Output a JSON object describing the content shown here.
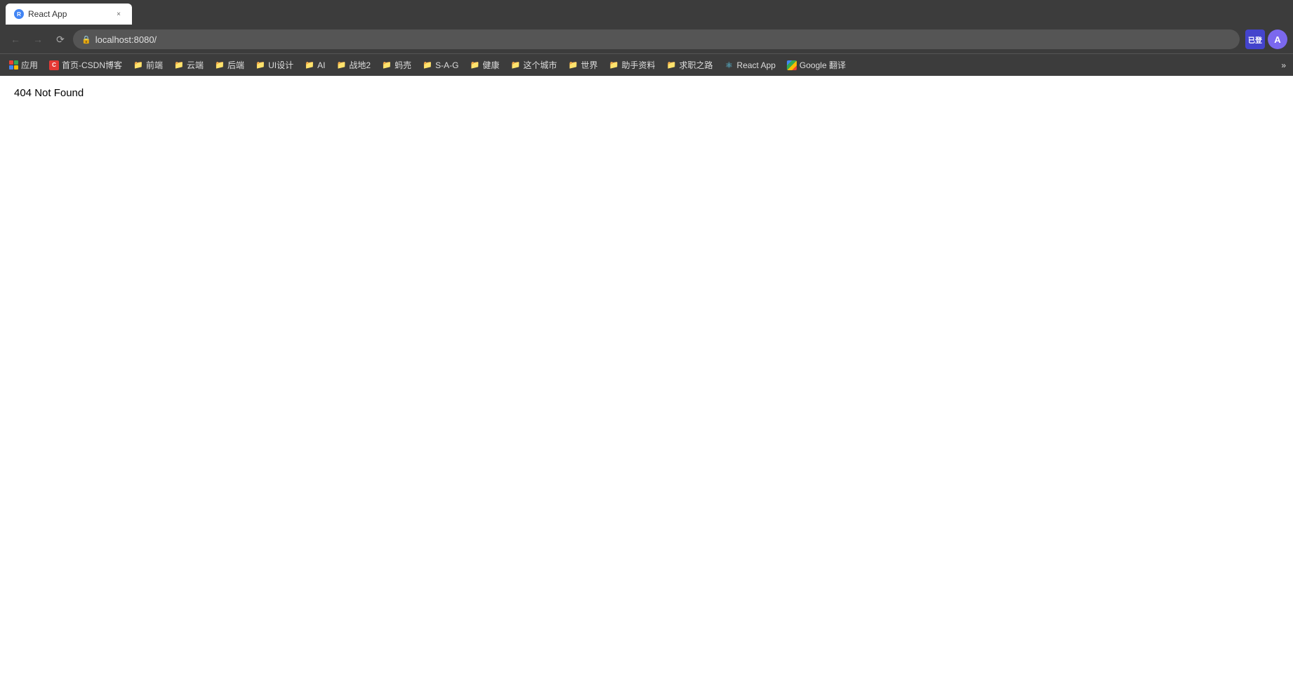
{
  "browser": {
    "tab": {
      "title": "React App",
      "favicon_label": "R"
    },
    "address_bar": {
      "url": "localhost:8080/"
    },
    "avatar_label": "A",
    "sync_label": "已登",
    "bookmarks": [
      {
        "id": "apps",
        "label": "应用",
        "type": "apps"
      },
      {
        "id": "csdn",
        "label": "首页-CSDN博客",
        "type": "csdn"
      },
      {
        "id": "qianduan",
        "label": "前端",
        "type": "folder"
      },
      {
        "id": "yunuan",
        "label": "云端",
        "type": "folder"
      },
      {
        "id": "houduan",
        "label": "后端",
        "type": "folder"
      },
      {
        "id": "uisheji",
        "label": "UI设计",
        "type": "folder"
      },
      {
        "id": "ai",
        "label": "AI",
        "type": "folder"
      },
      {
        "id": "zhandiwu",
        "label": "战地2",
        "type": "folder"
      },
      {
        "id": "maishou",
        "label": "蚂売",
        "type": "folder"
      },
      {
        "id": "sag",
        "label": "S-A-G",
        "type": "folder"
      },
      {
        "id": "jiankang",
        "label": "健康",
        "type": "folder"
      },
      {
        "id": "zhegechengshi",
        "label": "这个城市",
        "type": "folder"
      },
      {
        "id": "shijie",
        "label": "世界",
        "type": "folder"
      },
      {
        "id": "zhushuziliao",
        "label": "助手资料",
        "type": "folder"
      },
      {
        "id": "qiuzhizhilu",
        "label": "求职之路",
        "type": "folder"
      },
      {
        "id": "reactapp",
        "label": "React App",
        "type": "react"
      },
      {
        "id": "googlefanyi",
        "label": "Google 翻译",
        "type": "google"
      }
    ],
    "more_label": "»"
  },
  "page": {
    "error_text": "404 Not Found"
  }
}
